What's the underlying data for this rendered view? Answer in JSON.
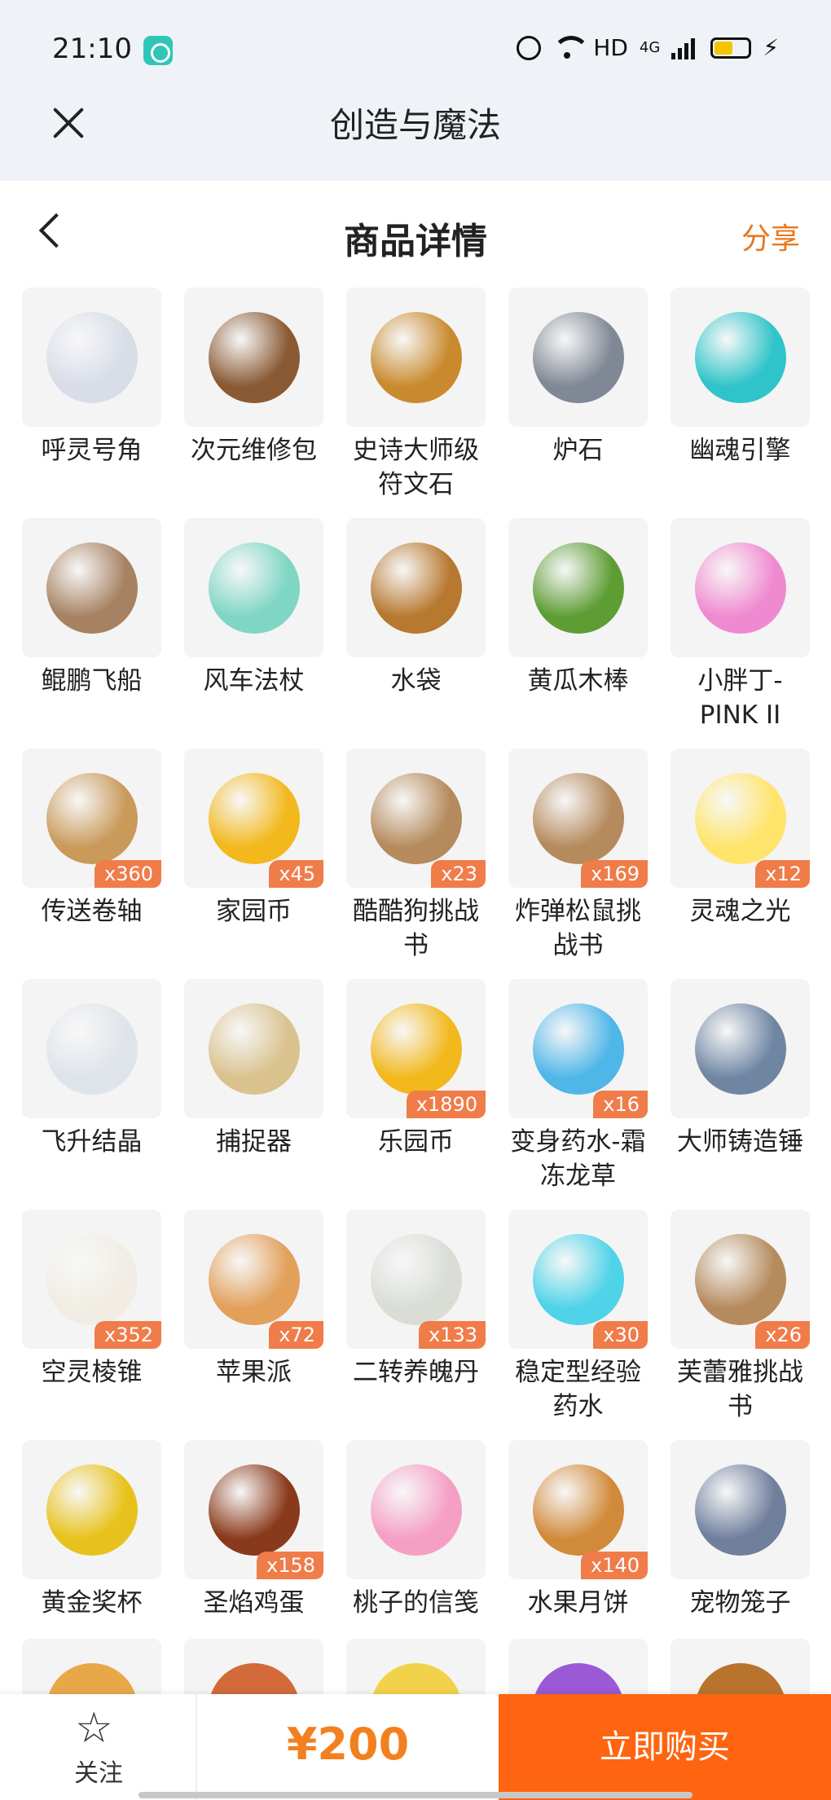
{
  "status_bar": {
    "time": "21:10",
    "hd_label": "HD",
    "network_label": "4G"
  },
  "app_bar": {
    "title": "创造与魔法"
  },
  "page_header": {
    "title": "商品详情",
    "share_label": "分享"
  },
  "items": [
    {
      "name": "呼灵号角",
      "qty": "",
      "icon": "horn-icon",
      "color": "#d8dde8"
    },
    {
      "name": "次元维修包",
      "qty": "",
      "icon": "repair-bag-icon",
      "color": "#8a5a34"
    },
    {
      "name": "史诗大师级符文石",
      "qty": "",
      "icon": "rune-stone-icon",
      "color": "#c98a2e"
    },
    {
      "name": "炉石",
      "qty": "",
      "icon": "hearthstone-icon",
      "color": "#7f8894"
    },
    {
      "name": "幽魂引擎",
      "qty": "",
      "icon": "ghost-engine-icon",
      "color": "#2ec4c9"
    },
    {
      "name": "鲲鹏飞船",
      "qty": "",
      "icon": "airship-icon",
      "color": "#a78262"
    },
    {
      "name": "风车法杖",
      "qty": "",
      "icon": "pinwheel-staff-icon",
      "color": "#7fd6c4"
    },
    {
      "name": "水袋",
      "qty": "",
      "icon": "water-bag-icon",
      "color": "#b7782f"
    },
    {
      "name": "黄瓜木棒",
      "qty": "",
      "icon": "cucumber-stick-icon",
      "color": "#5e9d34"
    },
    {
      "name": "小胖丁-PINK II",
      "qty": "",
      "icon": "pink-car-icon",
      "color": "#f08ad0"
    },
    {
      "name": "传送卷轴",
      "qty": "x360",
      "icon": "teleport-scroll-icon",
      "color": "#c99a5a"
    },
    {
      "name": "家园币",
      "qty": "x45",
      "icon": "home-coin-icon",
      "color": "#f2b81c"
    },
    {
      "name": "酷酷狗挑战书",
      "qty": "x23",
      "icon": "wanted-poster-icon",
      "color": "#b58a5c"
    },
    {
      "name": "炸弹松鼠挑战书",
      "qty": "x169",
      "icon": "wanted-poster-icon",
      "color": "#b58a5c"
    },
    {
      "name": "灵魂之光",
      "qty": "x12",
      "icon": "soul-light-icon",
      "color": "#ffe46b"
    },
    {
      "name": "飞升结晶",
      "qty": "",
      "icon": "ascension-crystal-icon",
      "color": "#dfe4ea"
    },
    {
      "name": "捕捉器",
      "qty": "",
      "icon": "catcher-icon",
      "color": "#d9c28e"
    },
    {
      "name": "乐园币",
      "qty": "x1890",
      "icon": "park-coin-icon",
      "color": "#f2b81c"
    },
    {
      "name": "变身药水-霜冻龙草",
      "qty": "x16",
      "icon": "potion-icon",
      "color": "#4fb6e8"
    },
    {
      "name": "大师铸造锤",
      "qty": "",
      "icon": "hammer-icon",
      "color": "#6f86a3"
    },
    {
      "name": "空灵棱锥",
      "qty": "x352",
      "icon": "pyramid-icon",
      "color": "#f1ede4"
    },
    {
      "name": "苹果派",
      "qty": "x72",
      "icon": "apple-pie-icon",
      "color": "#e2a05a"
    },
    {
      "name": "二转养魄丹",
      "qty": "x133",
      "icon": "elixir-bottle-icon",
      "color": "#d9ddd6"
    },
    {
      "name": "稳定型经验药水",
      "qty": "x30",
      "icon": "exp-potion-icon",
      "color": "#4fd3e8"
    },
    {
      "name": "芙蕾雅挑战书",
      "qty": "x26",
      "icon": "wanted-poster-icon",
      "color": "#b58a5c"
    },
    {
      "name": "黄金奖杯",
      "qty": "",
      "icon": "trophy-icon",
      "color": "#e8c21c"
    },
    {
      "name": "圣焰鸡蛋",
      "qty": "x158",
      "icon": "egg-icon",
      "color": "#8a3a1c"
    },
    {
      "name": "桃子的信笺",
      "qty": "",
      "icon": "letter-icon",
      "color": "#f59fc4"
    },
    {
      "name": "水果月饼",
      "qty": "x140",
      "icon": "mooncake-icon",
      "color": "#d18a3a"
    },
    {
      "name": "宠物笼子",
      "qty": "",
      "icon": "pet-cage-icon",
      "color": "#6f7f9c"
    }
  ],
  "partial_row_colors": [
    "#e8a84a",
    "#d26a3a",
    "#f2d24a",
    "#9a5ad6",
    "#b8742c"
  ],
  "bottom_bar": {
    "follow_label": "关注",
    "price": "¥200",
    "buy_label": "立即购买"
  }
}
